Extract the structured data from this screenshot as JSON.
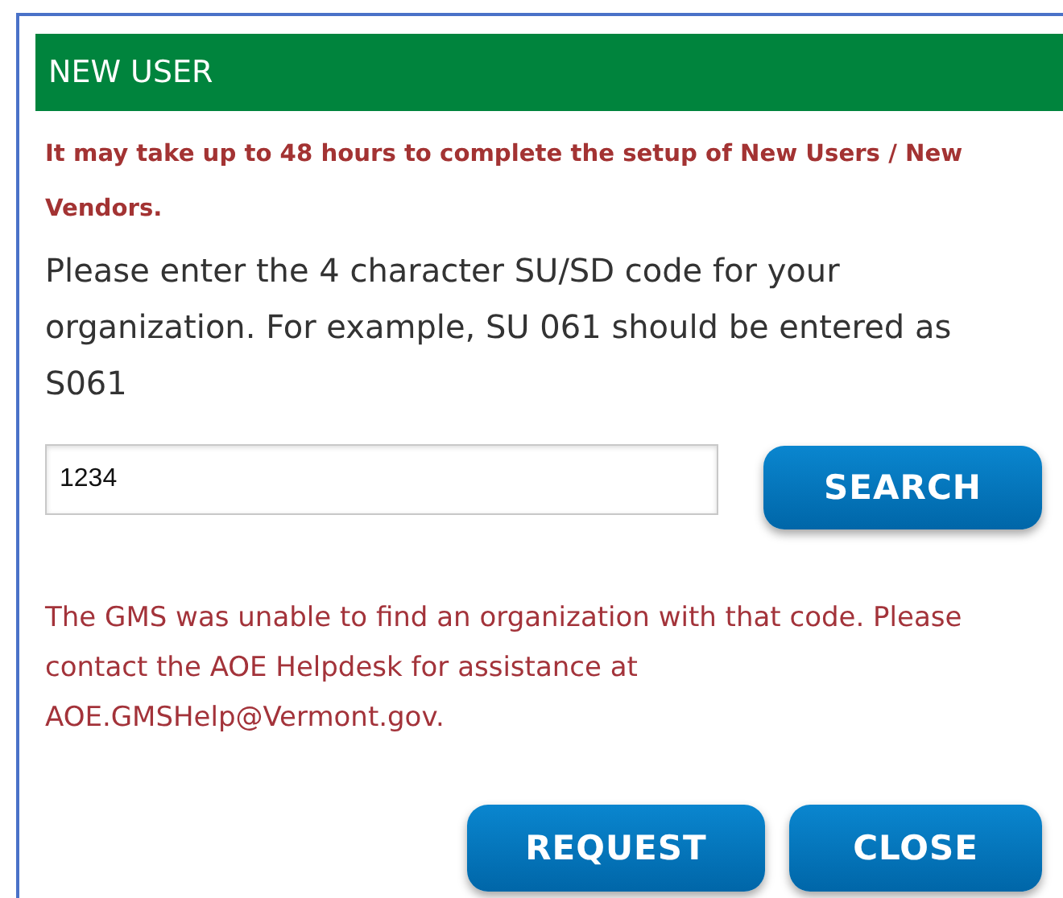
{
  "dialog": {
    "title": "NEW USER"
  },
  "notice": "It may take up to 48 hours to complete the setup of New Users / New Vendors.",
  "instructions": "Please enter the 4 character SU/SD code for your organization. For example, SU 061 should be entered as S061",
  "code_field": {
    "value": "1234"
  },
  "search_button": "SEARCH",
  "error_message": "The GMS was unable to find an organization with that code. Please contact the AOE Helpdesk for assistance at AOE.GMSHelp@Vermont.gov.",
  "buttons": [
    "REQUEST",
    "CLOSE"
  ]
}
